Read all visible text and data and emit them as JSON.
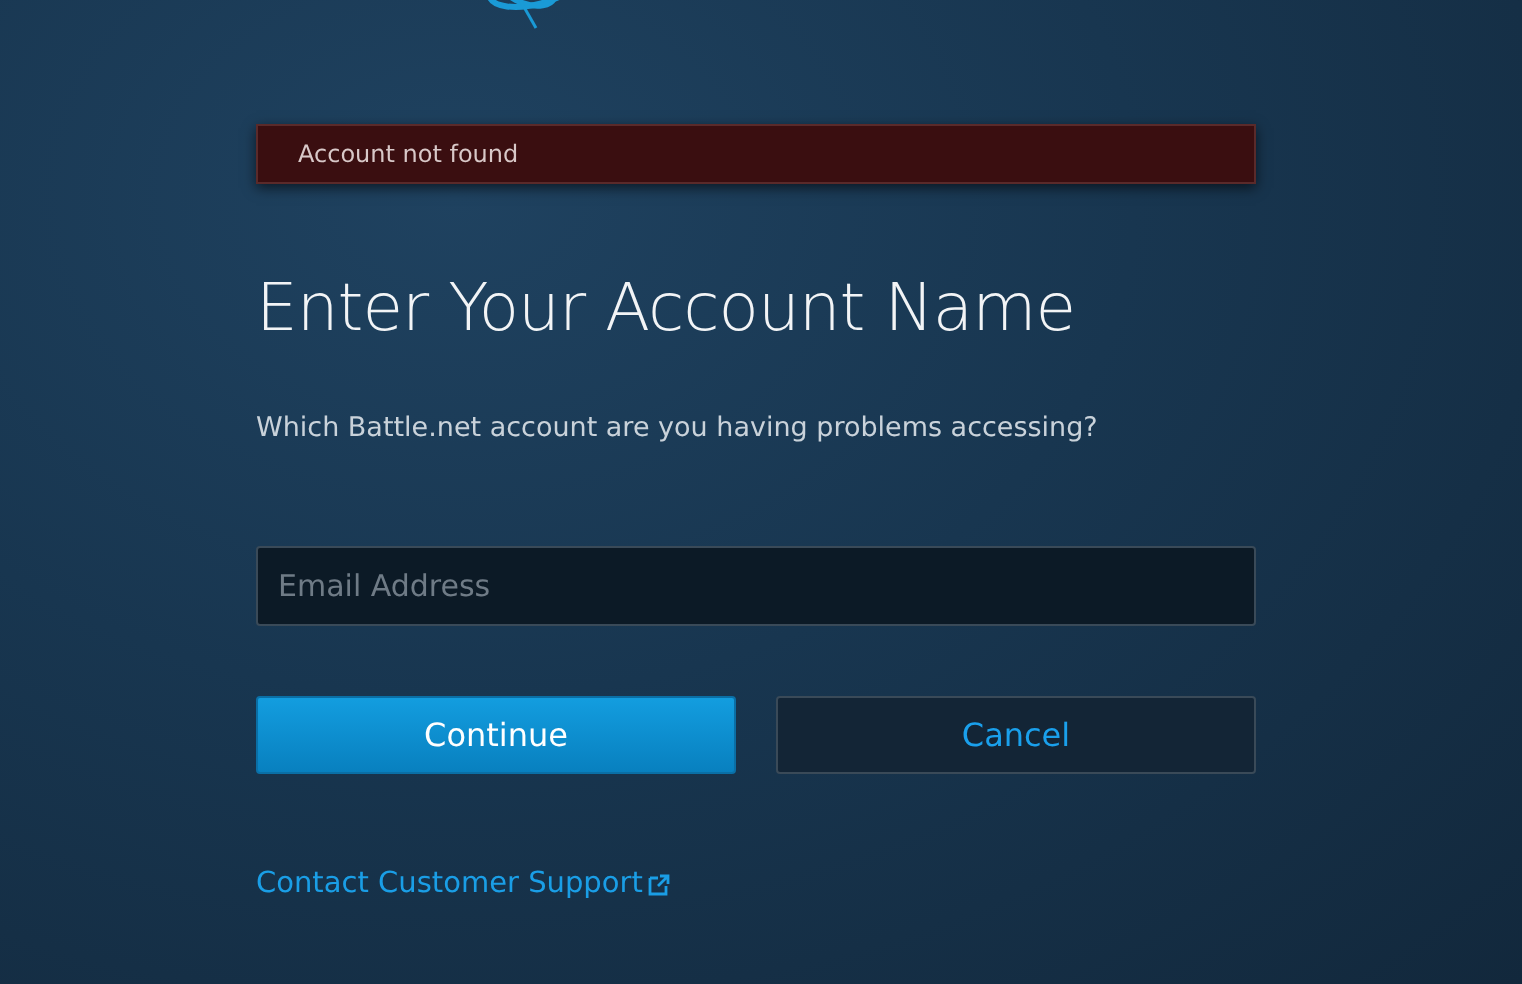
{
  "alert": {
    "message": "Account not found"
  },
  "heading": "Enter Your Account Name",
  "prompt": "Which Battle.net account are you having problems accessing?",
  "email_field": {
    "placeholder": "Email Address"
  },
  "buttons": [
    {
      "label": "Continue",
      "kind": "primary"
    },
    {
      "label": "Cancel",
      "kind": "secondary"
    }
  ],
  "support_link": {
    "label": "Contact Customer Support"
  }
}
